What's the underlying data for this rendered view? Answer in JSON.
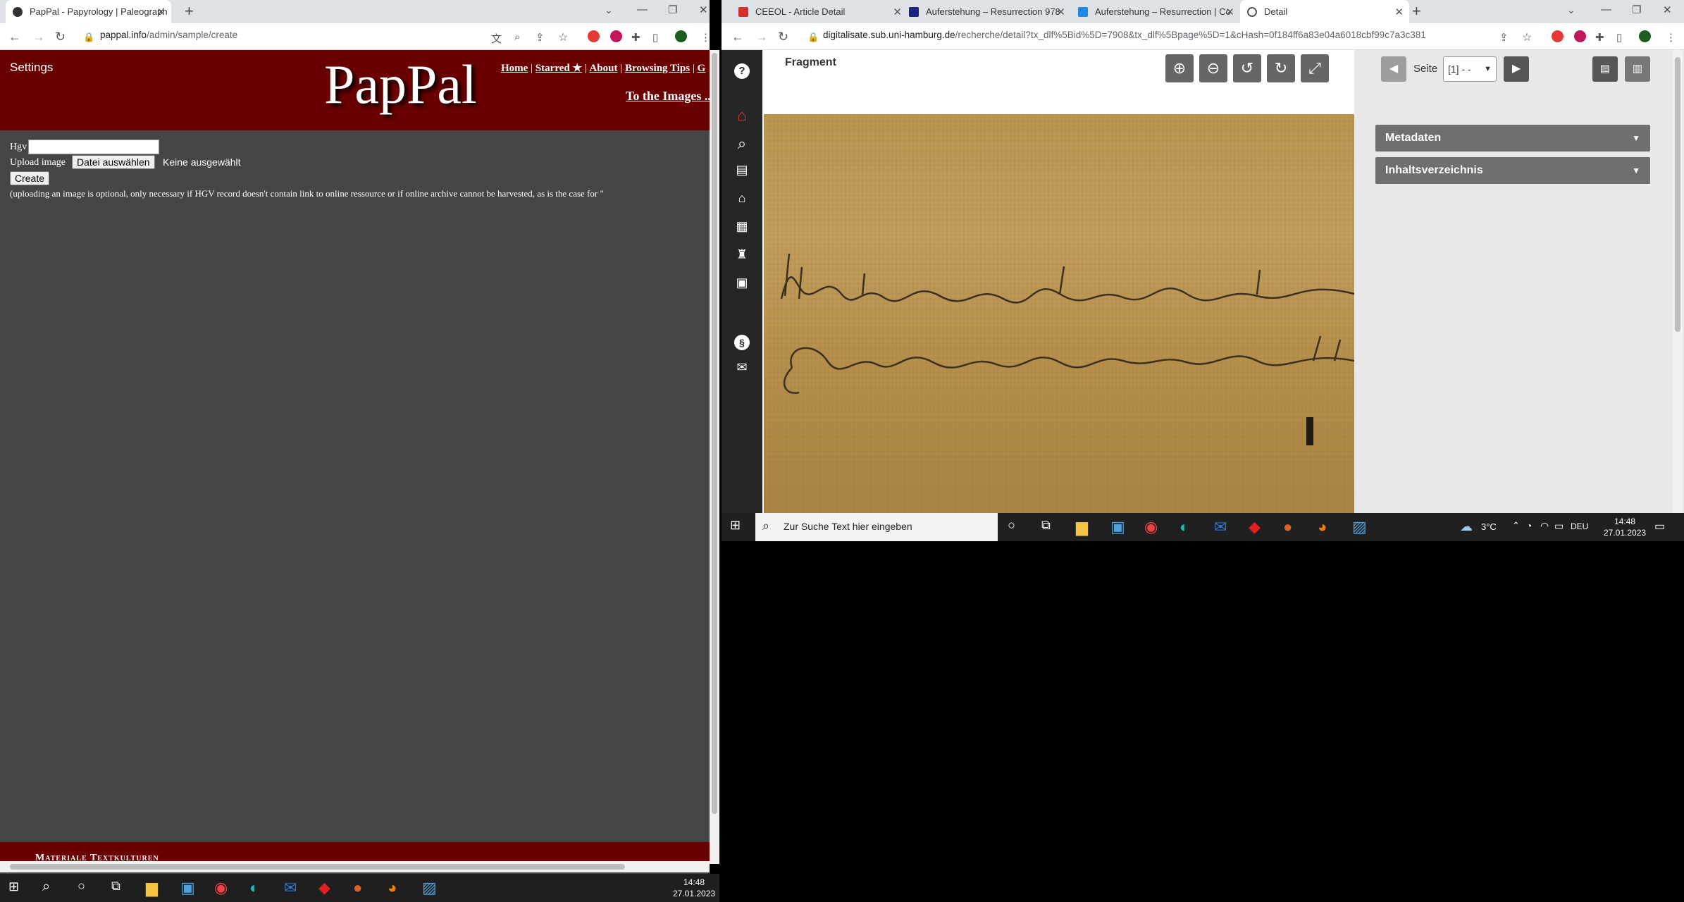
{
  "left_browser": {
    "tabs": [
      {
        "label": "PapPal - Papyrology | Paleograph",
        "active": true
      }
    ],
    "url": {
      "host": "pappal.info",
      "path": "/admin/sample/create"
    },
    "new_tab": "+",
    "window_controls": {
      "minimize": "—",
      "restore": "❐",
      "close": "✕"
    }
  },
  "pappal": {
    "settings": "Settings",
    "logo": "PapPal",
    "nav": [
      "Home",
      "Starred ★",
      "About",
      "Browsing Tips",
      "G"
    ],
    "separator": "|",
    "to_images": "To the Images ...",
    "form": {
      "hgv_label": "Hgv",
      "hgv_value": "",
      "upload_label": "Upload image",
      "file_button": "Datei auswählen",
      "file_status": "Keine ausgewählt",
      "create_button": "Create",
      "note": "(uploading an image is optional, only necessary if HGV record doesn't contain link to online ressource or if online archive cannot be harvested, as is the case for \""
    },
    "footer": "Materiale Textkulturen"
  },
  "right_browser": {
    "tabs": [
      {
        "label": "CEEOL - Article Detail",
        "active": false
      },
      {
        "label": "Auferstehung – Resurrection 978",
        "active": false
      },
      {
        "label": "Auferstehung – Resurrection | Co",
        "active": false
      },
      {
        "label": "Detail",
        "active": true
      }
    ],
    "url": {
      "host": "digitalisate.sub.uni-hamburg.de",
      "path": "/recherche/detail?tx_dlf%5Bid%5D=7908&tx_dlf%5Bpage%5D=1&cHash=0f184ff6a83e04a6018cbf99c7a3c381"
    }
  },
  "viewer": {
    "title": "Fragment",
    "page_label": "Seite",
    "page_value": "[1] - -",
    "accordions": [
      "Metadaten",
      "Inhaltsverzeichnis"
    ],
    "side_icons": [
      "help-icon",
      "home-icon",
      "search-icon",
      "chat-icon",
      "museum-icon",
      "grid-icon",
      "tree-icon",
      "calendar-icon",
      "paragraph-icon",
      "mail-icon"
    ]
  },
  "taskbar_right": {
    "search_placeholder": "Zur Suche Text hier eingeben",
    "weather": "3°C",
    "lang": "DEU",
    "time": "14:48",
    "date": "27.01.2023"
  },
  "taskbar_left": {
    "time": "14:48",
    "date": "27.01.2023"
  }
}
